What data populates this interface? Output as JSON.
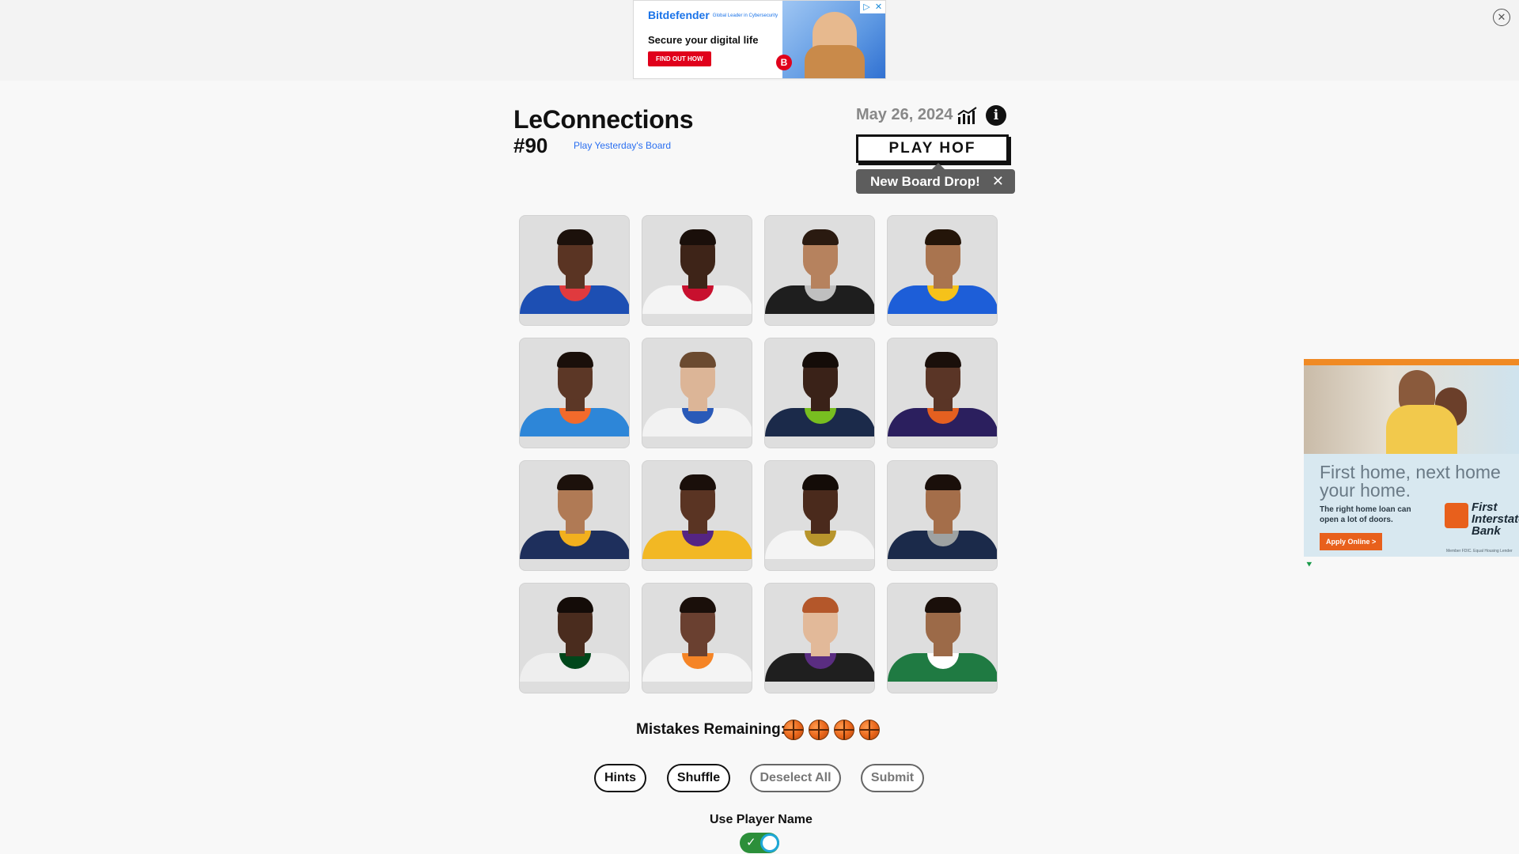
{
  "top_ad": {
    "brand": "Bitdefender",
    "brand_sub": "Global Leader in Cybersecurity",
    "tagline": "Secure your digital life",
    "cta": "FIND OUT HOW",
    "badge": "B"
  },
  "header": {
    "title": "LeConnections",
    "number": "#90",
    "yesterday_link": "Play Yesterday's Board",
    "date": "May 26, 2024",
    "play_hof": "PLAY HOF",
    "tooltip": "New Board Drop!"
  },
  "tiles": [
    {
      "jersey": "#1d4fb3",
      "trim": "#e03a3e",
      "skin": "#5a3423",
      "hair": "#1c110b"
    },
    {
      "jersey": "#f4f4f4",
      "trim": "#c8102e",
      "skin": "#3e2418",
      "hair": "#1a0f0a"
    },
    {
      "jersey": "#1e1e1e",
      "trim": "#bfbfbf",
      "skin": "#b6825e",
      "hair": "#2a1a10"
    },
    {
      "jersey": "#1d5ed8",
      "trim": "#f5c21a",
      "skin": "#a9744f",
      "hair": "#241509"
    },
    {
      "jersey": "#2d86d8",
      "trim": "#f26a2b",
      "skin": "#5c3726",
      "hair": "#1a0f0a"
    },
    {
      "jersey": "#f2f2f2",
      "trim": "#2a5ab8",
      "skin": "#dcb597",
      "hair": "#6b4a30"
    },
    {
      "jersey": "#1b2a4a",
      "trim": "#78be20",
      "skin": "#3a2218",
      "hair": "#140c08"
    },
    {
      "jersey": "#2b1f5e",
      "trim": "#e56020",
      "skin": "#5a3526",
      "hair": "#1a0f0a"
    },
    {
      "jersey": "#1e2f5c",
      "trim": "#f2b01e",
      "skin": "#b07a55",
      "hair": "#1c110b"
    },
    {
      "jersey": "#f2b824",
      "trim": "#552583",
      "skin": "#5a3423",
      "hair": "#1a0f0a"
    },
    {
      "jersey": "#f4f4f4",
      "trim": "#b8952c",
      "skin": "#4a2a1c",
      "hair": "#140c08"
    },
    {
      "jersey": "#1b2a4a",
      "trim": "#9ea2a2",
      "skin": "#a46e4a",
      "hair": "#1a0f0a"
    },
    {
      "jersey": "#eeeeee",
      "trim": "#00471b",
      "skin": "#4a2c1e",
      "hair": "#140c08"
    },
    {
      "jersey": "#f4f4f4",
      "trim": "#f58426",
      "skin": "#6a4030",
      "hair": "#1a0f0a"
    },
    {
      "jersey": "#1f1f1f",
      "trim": "#5a2d81",
      "skin": "#e2b999",
      "hair": "#b4572a"
    },
    {
      "jersey": "#1f7a42",
      "trim": "#ffffff",
      "skin": "#9c6a48",
      "hair": "#1a0f0a"
    }
  ],
  "mistakes": {
    "label": "Mistakes Remaining:",
    "remaining": 4
  },
  "buttons": {
    "hints": "Hints",
    "shuffle": "Shuffle",
    "deselect": "Deselect All",
    "submit": "Submit"
  },
  "use_player_name": {
    "label": "Use Player Name",
    "enabled": true
  },
  "side_ad": {
    "headline": "First home, next home your home.",
    "sub": "The right home loan can open a lot of doors.",
    "apply": "Apply Online >",
    "logo": "First Interstate Bank",
    "fine": "Member FDIC. Equal Housing Lender"
  }
}
